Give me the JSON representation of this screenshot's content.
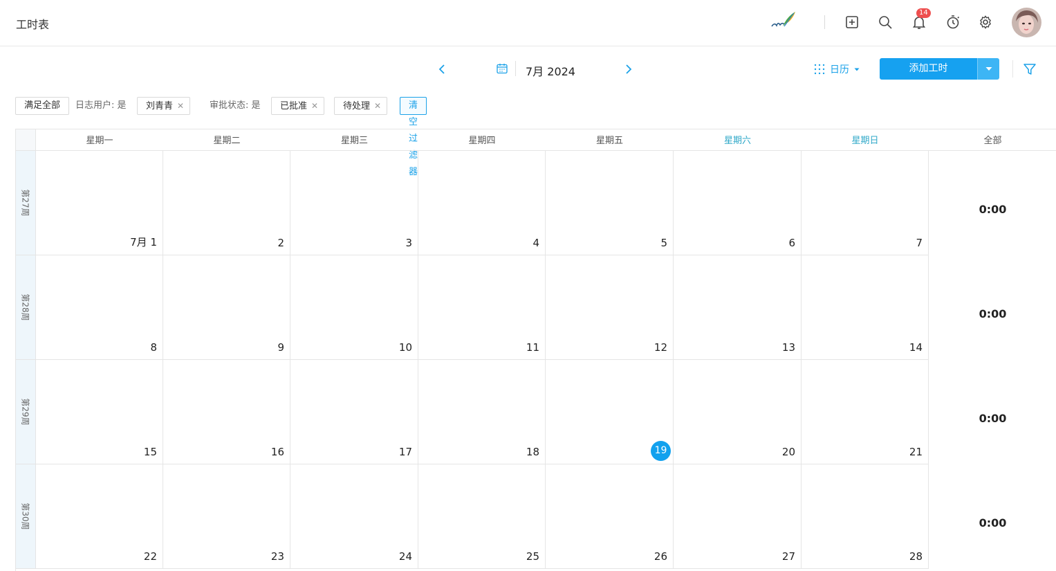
{
  "app": {
    "title": "工时表"
  },
  "header": {
    "notification_count": "14",
    "icons": [
      "logo-quill-icon",
      "add-square-icon",
      "search-icon",
      "bell-icon",
      "timer-icon",
      "gear-icon",
      "avatar"
    ]
  },
  "toolbar": {
    "month_label": "7月 2024",
    "view_label": "日历",
    "add_label": "添加工时",
    "accent_color": "#16a1f0"
  },
  "filters": {
    "match_all": "满足全部",
    "user_label": "日志用户: 是",
    "user_value": "刘青青",
    "status_label": "审批状态: 是",
    "status_values": [
      "已批准",
      "待处理"
    ],
    "clear_label": "清空过滤器"
  },
  "calendar": {
    "weekday_headers": [
      "星期一",
      "星期二",
      "星期三",
      "星期四",
      "星期五",
      "星期六",
      "星期日",
      "全部"
    ],
    "weeks": [
      {
        "label": "第27周",
        "days": [
          "7月 1",
          "2",
          "3",
          "4",
          "5",
          "6",
          "7"
        ],
        "total": "0:00"
      },
      {
        "label": "第28周",
        "days": [
          "8",
          "9",
          "10",
          "11",
          "12",
          "13",
          "14"
        ],
        "total": "0:00"
      },
      {
        "label": "第29周",
        "days": [
          "15",
          "16",
          "17",
          "18",
          "19",
          "20",
          "21"
        ],
        "total": "0:00"
      },
      {
        "label": "第30周",
        "days": [
          "22",
          "23",
          "24",
          "25",
          "26",
          "27",
          "28"
        ],
        "total": "0:00"
      }
    ],
    "today": "19"
  }
}
